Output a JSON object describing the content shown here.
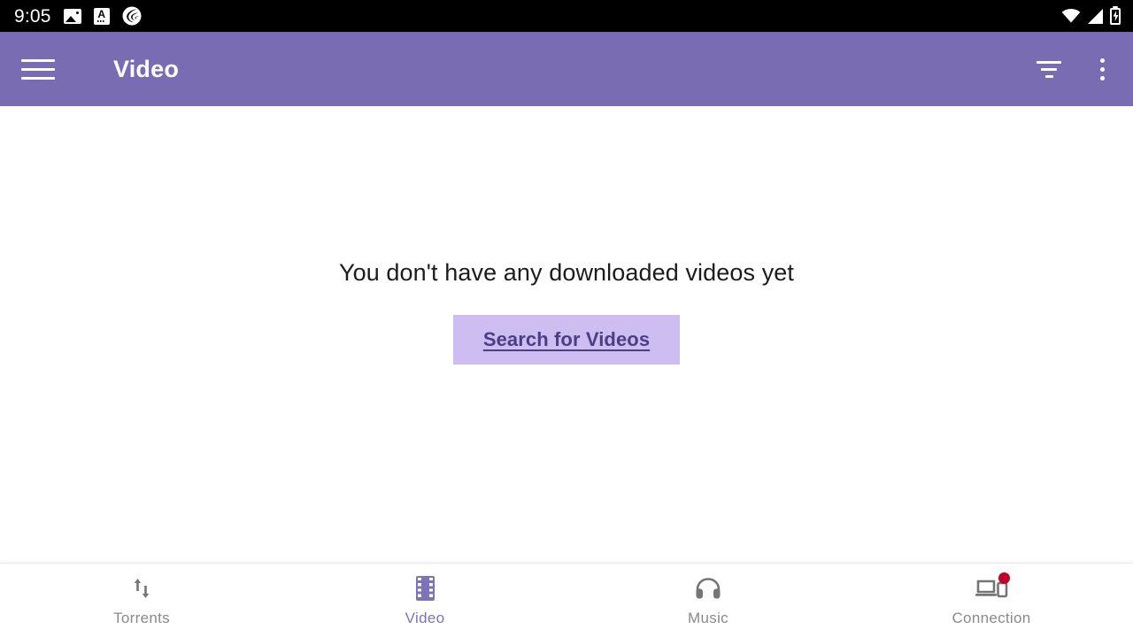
{
  "status_bar": {
    "clock": "9:05",
    "left_icons": [
      {
        "name": "photo-icon",
        "glyph": "image"
      },
      {
        "name": "text-file-icon",
        "glyph": "A"
      },
      {
        "name": "bittorrent-icon",
        "glyph": "spiral"
      }
    ],
    "right_icons": [
      {
        "name": "wifi-icon"
      },
      {
        "name": "cell-signal-icon"
      },
      {
        "name": "battery-charging-icon"
      }
    ],
    "background": "#000000",
    "foreground": "#ffffff"
  },
  "app_bar": {
    "menu_icon": "hamburger-menu-icon",
    "title": "Video",
    "filter_icon": "filter-sort-icon",
    "overflow_icon": "overflow-menu-icon",
    "background": "#7a6cb2",
    "text_color": "#ffffff"
  },
  "content": {
    "empty_message": "You don't have any downloaded videos yet",
    "search_button_label": "Search for Videos",
    "search_button_background": "#cdbdf0",
    "search_button_text_color": "#4a3f85",
    "background": "#ffffff"
  },
  "bottom_nav": {
    "active_color": "#7e72bb",
    "inactive_color": "#8a8a8a",
    "items": [
      {
        "label": "Torrents",
        "icon": "transfer-arrows-icon",
        "active": false,
        "badge": false
      },
      {
        "label": "Video",
        "icon": "film-strip-icon",
        "active": true,
        "badge": false
      },
      {
        "label": "Music",
        "icon": "headphones-icon",
        "active": false,
        "badge": false
      },
      {
        "label": "Connection",
        "icon": "devices-cast-icon",
        "active": false,
        "badge": true,
        "badge_color": "#c1002b"
      }
    ]
  }
}
